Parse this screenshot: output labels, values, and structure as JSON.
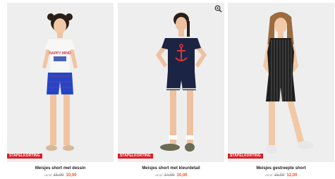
{
  "colors": {
    "photo_background": "#eeeeee",
    "promo_badge": "#d71f26",
    "sale_price": "#e8562a",
    "old_price": "#999999"
  },
  "products": [
    {
      "title": "Meisjes short met dessin",
      "badge": "STAPELKORTING",
      "price_prefix": "vanaf",
      "old_price": "15,99",
      "new_price": "10,00",
      "shirt_text": "HAPPY MIND",
      "image_icon": "girl-white-tshirt-blue-shorts"
    },
    {
      "title": "Meisjes short met kleurdetail",
      "badge": "STAPELKORTING",
      "price_prefix": "vanaf",
      "old_price": "14,99",
      "new_price": "10,00",
      "image_icon": "girl-navy-anchor-tshirt-navy-shorts",
      "overlay_icon": "zoom-icon"
    },
    {
      "title": "Meisjes gestreepte short",
      "badge": "STAPELKORTING",
      "price_prefix": "vanaf",
      "old_price": "15,99",
      "new_price": "12,00",
      "image_icon": "girl-black-striped-playsuit"
    }
  ]
}
